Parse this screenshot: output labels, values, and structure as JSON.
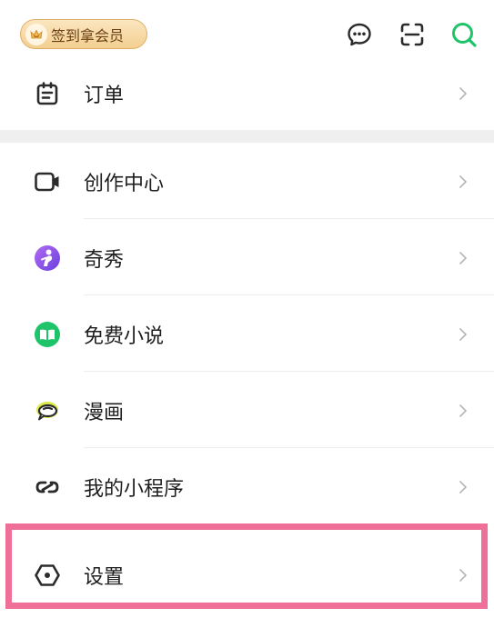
{
  "header": {
    "member_badge_label": "签到拿会员"
  },
  "menu": {
    "orders": {
      "label": "订单",
      "icon": "clipboard-icon"
    },
    "creator_center": {
      "label": "创作中心",
      "icon": "video-camera-icon"
    },
    "qixiu": {
      "label": "奇秀",
      "icon": "qixiu-logo-icon"
    },
    "free_novels": {
      "label": "免费小说",
      "icon": "open-book-icon"
    },
    "comics": {
      "label": "漫画",
      "icon": "comic-bubble-icon"
    },
    "mini_programs": {
      "label": "我的小程序",
      "icon": "link-icon"
    },
    "settings": {
      "label": "设置",
      "icon": "hexagon-gear-icon"
    }
  },
  "colors": {
    "accent_green": "#1fc36a",
    "highlight_pink": "#ef6f98",
    "badge_gold": "#f3cf91",
    "qixiu_purple": "#8a4ee8",
    "icon_dark": "#2b2b2b",
    "chevron_gray": "#b5b5b5"
  }
}
